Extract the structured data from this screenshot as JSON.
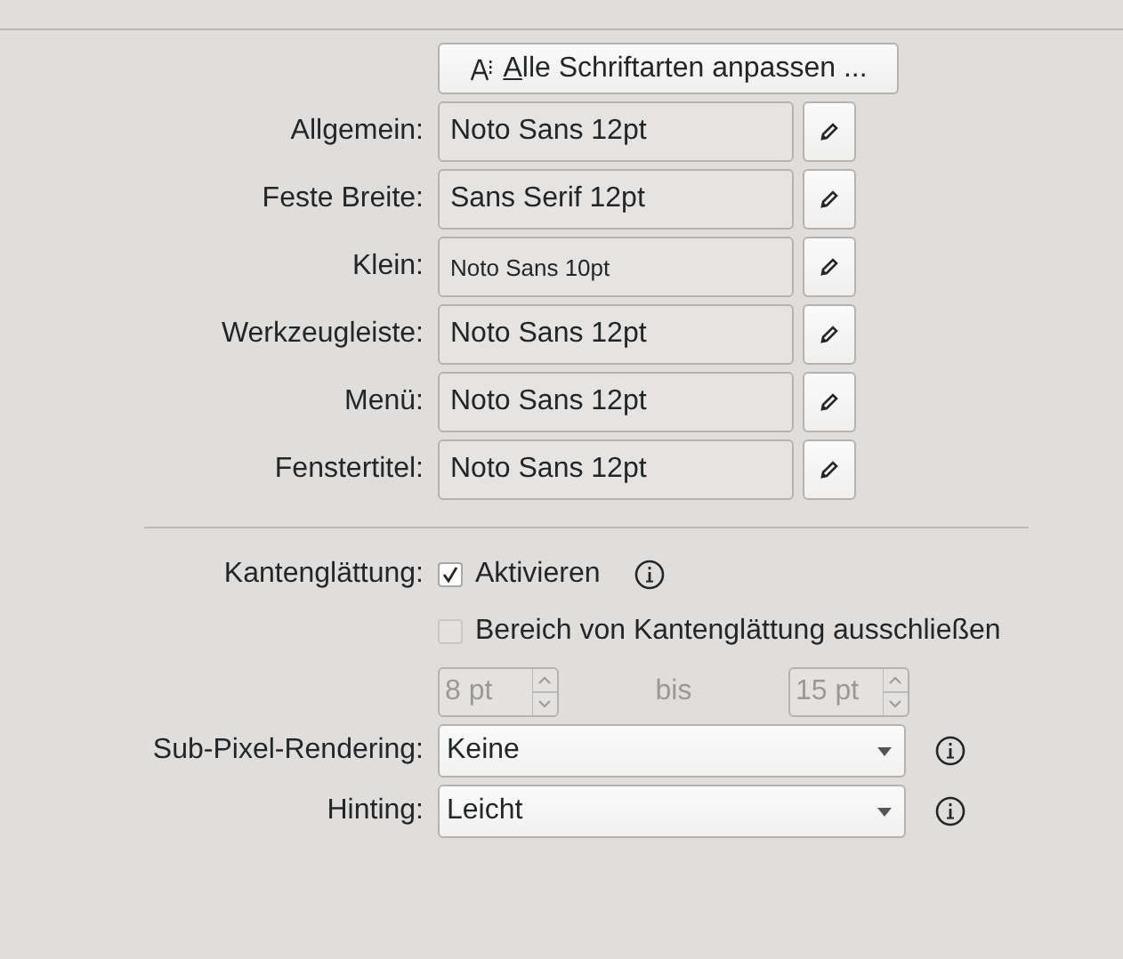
{
  "adjust_all_button": {
    "label": "Alle Schriftarten anpassen ..."
  },
  "fonts": [
    {
      "label": "Allgemein:",
      "value": "Noto Sans 12pt",
      "kind": "normal"
    },
    {
      "label": "Feste Breite:",
      "value": "Sans Serif 12pt",
      "kind": "normal"
    },
    {
      "label": "Klein:",
      "value": "Noto Sans 10pt",
      "kind": "small"
    },
    {
      "label": "Werkzeugleiste:",
      "value": "Noto Sans 12pt",
      "kind": "normal"
    },
    {
      "label": "Menü:",
      "value": "Noto Sans 12pt",
      "kind": "normal"
    },
    {
      "label": "Fenstertitel:",
      "value": "Noto Sans 12pt",
      "kind": "normal"
    }
  ],
  "antialiasing": {
    "label": "Kantenglättung:",
    "enable": {
      "label": "Aktivieren",
      "checked": true
    },
    "exclude": {
      "label": "Bereich von Kantenglättung ausschließen",
      "checked": false,
      "disabled": true
    },
    "range": {
      "from": "8 pt",
      "separator": "bis",
      "to": "15 pt",
      "disabled": true
    }
  },
  "subpixel": {
    "label": "Sub-Pixel-Rendering:",
    "value": "Keine"
  },
  "hinting": {
    "label": "Hinting:",
    "value": "Leicht"
  }
}
